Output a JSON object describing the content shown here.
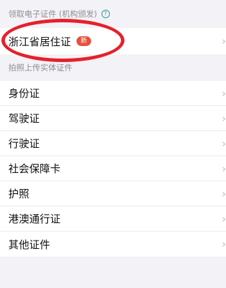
{
  "sections": [
    {
      "header": "领取电子证件 (机构颁发)",
      "help_icon": "question-circle-icon",
      "items": [
        {
          "label": "浙江省居住证",
          "badge": "新"
        }
      ]
    },
    {
      "header": "拍照上传实体证件",
      "items": [
        {
          "label": "身份证"
        },
        {
          "label": "驾驶证"
        },
        {
          "label": "行驶证"
        },
        {
          "label": "社会保障卡"
        },
        {
          "label": "护照"
        },
        {
          "label": "港澳通行证"
        },
        {
          "label": "其他证件"
        }
      ]
    }
  ],
  "chevron": "›",
  "colors": {
    "accent_teal": "#2a9d8f",
    "badge_red": "#e9503a",
    "annotation_red": "#e6202a"
  }
}
